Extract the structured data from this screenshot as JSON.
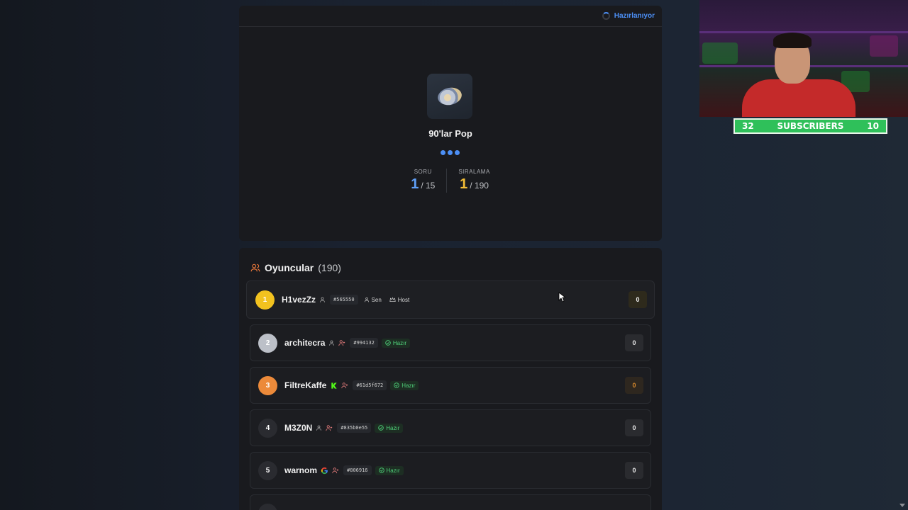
{
  "status": {
    "label": "Hazırlanıyor"
  },
  "quiz": {
    "title": "90'lar Pop",
    "question_label": "SORU",
    "question_current": "1",
    "question_total": "/ 15",
    "rank_label": "SIRALAMA",
    "rank_current": "1",
    "rank_total": "/ 190"
  },
  "players": {
    "title": "Oyuncular",
    "count": "(190)",
    "items": [
      {
        "rank": "1",
        "name": "H1vezZz",
        "id": "#565550",
        "badges": [
          "Sen",
          "Host"
        ],
        "score": "0"
      },
      {
        "rank": "2",
        "name": "architecra",
        "id": "#994132",
        "badges": [
          "Hazır"
        ],
        "score": "0"
      },
      {
        "rank": "3",
        "name": "FiltreKaffe",
        "id": "#61d5f672",
        "badges": [
          "Hazır"
        ],
        "score": "0"
      },
      {
        "rank": "4",
        "name": "M3Z0N",
        "id": "#835b0e55",
        "badges": [
          "Hazır"
        ],
        "score": "0"
      },
      {
        "rank": "5",
        "name": "warnom",
        "id": "#806916",
        "badges": [
          "Hazır"
        ],
        "score": "0"
      }
    ]
  },
  "overlay": {
    "subs_left": "32",
    "subs_label": "SUBSCRIBERS",
    "subs_right": "10"
  },
  "colors": {
    "accent": "#4c8ff5",
    "gold": "#f2bd36",
    "ready": "#4fd07a",
    "subs_bar": "#2fc05a"
  }
}
